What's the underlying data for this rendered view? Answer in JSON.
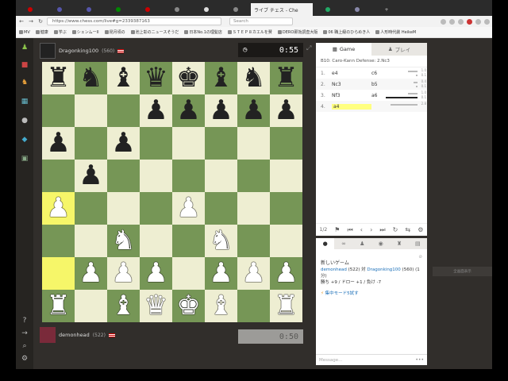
{
  "browser": {
    "active_tab_title": "ライブ チェス - Che",
    "url": "https://www.chess.com/live#g=2339387163",
    "search_placeholder": "Search",
    "bookmarks": [
      "MV",
      "健康",
      "学ぶ",
      "シェンムーII",
      "昆月頃の",
      "池上彰のニュースそうだ",
      "日本No.1の理髪店",
      "ＳＴＥＰ８カエルを賛",
      "DERO即効調査大阪",
      "06 職上級のひらめき人",
      "人形時代劇 HeikeM"
    ]
  },
  "top_player": {
    "name": "Dragonking100",
    "rating": "(560)",
    "clock": "0:55"
  },
  "bottom_player": {
    "name": "demonhead",
    "rating": "(522)",
    "clock": "0:50"
  },
  "game_panel": {
    "tabs": [
      "Game",
      "プレイ"
    ],
    "opening": "B10: Caro-Kann Defense: 2.Nc3",
    "moves": [
      {
        "num": "1.",
        "white": "e4",
        "black": "c6",
        "t1": "1.0",
        "t2": "0.1"
      },
      {
        "num": "2.",
        "white": "Nc3",
        "black": "b5",
        "t1": "0.4",
        "t2": "0.1"
      },
      {
        "num": "3.",
        "white": "Nf3",
        "black": "a6",
        "t1": "1.0",
        "t2": "0.1"
      },
      {
        "num": "4.",
        "white": "a4",
        "black": "",
        "t1": "2.8",
        "t2": ""
      }
    ],
    "controls_label": "1/2"
  },
  "chat": {
    "title": "新しいゲーム",
    "player1": "demonhead",
    "rating1": "(522)",
    "vs": "対",
    "player2": "Dragonking100",
    "rating2": "(560)",
    "time_control": "(1分)",
    "stats": "勝ち +9 / ドロー +1 / 負け -7",
    "focus_mode": "集中モード5試す",
    "input_placeholder": "Message...",
    "input_menu": "•••"
  },
  "right_button": "全画面表示",
  "board": [
    [
      "br",
      "bn",
      "bb",
      "bq",
      "bk",
      "bb",
      "bn",
      "br"
    ],
    [
      "",
      "",
      "",
      "bp",
      "bp",
      "bp",
      "bp",
      "bp"
    ],
    [
      "bp",
      "",
      "bp",
      "",
      "",
      "",
      "",
      ""
    ],
    [
      "",
      "bp",
      "",
      "",
      "",
      "",
      "",
      ""
    ],
    [
      "wp",
      "",
      "",
      "",
      "wp",
      "",
      "",
      ""
    ],
    [
      "",
      "",
      "wn",
      "",
      "",
      "wn",
      "",
      ""
    ],
    [
      "",
      "wp",
      "wp",
      "wp",
      "",
      "wp",
      "wp",
      "wp"
    ],
    [
      "wr",
      "",
      "wb",
      "wq",
      "wk",
      "wb",
      "",
      "wr"
    ]
  ],
  "highlights": [
    [
      4,
      0
    ],
    [
      6,
      0
    ]
  ],
  "colors": {
    "light": "#eeeed2",
    "dark": "#769656",
    "highlight": "#f6f669"
  }
}
